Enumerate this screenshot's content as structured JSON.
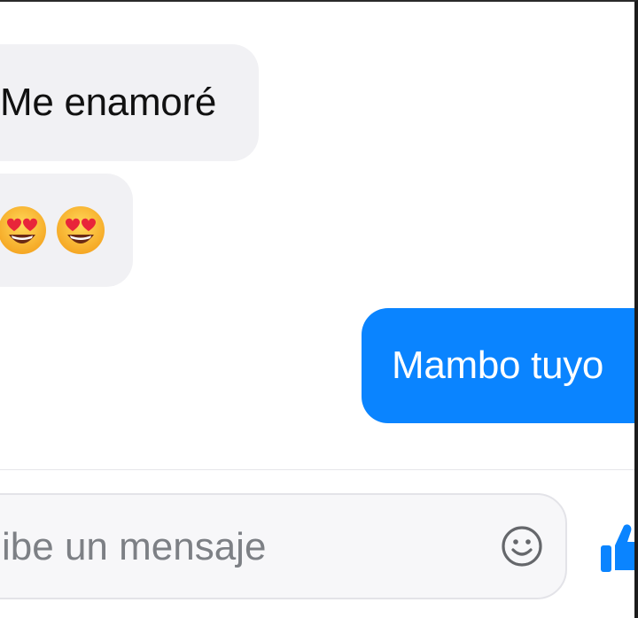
{
  "messages": [
    {
      "direction": "incoming",
      "text": "Me enamoré"
    },
    {
      "direction": "incoming",
      "emoji": [
        "smiling-face-with-heart-eyes",
        "smiling-face-with-heart-eyes"
      ]
    },
    {
      "direction": "outgoing",
      "text": "Mambo tuyo"
    }
  ],
  "composer": {
    "placeholder": "ibe un mensaje",
    "emoji_button_icon": "smiley-icon",
    "like_button_icon": "thumbs-up-icon"
  },
  "colors": {
    "incoming_bubble": "#f1f1f4",
    "outgoing_bubble": "#0a84ff",
    "accent": "#0a84ff",
    "placeholder_text": "#7d8085"
  }
}
